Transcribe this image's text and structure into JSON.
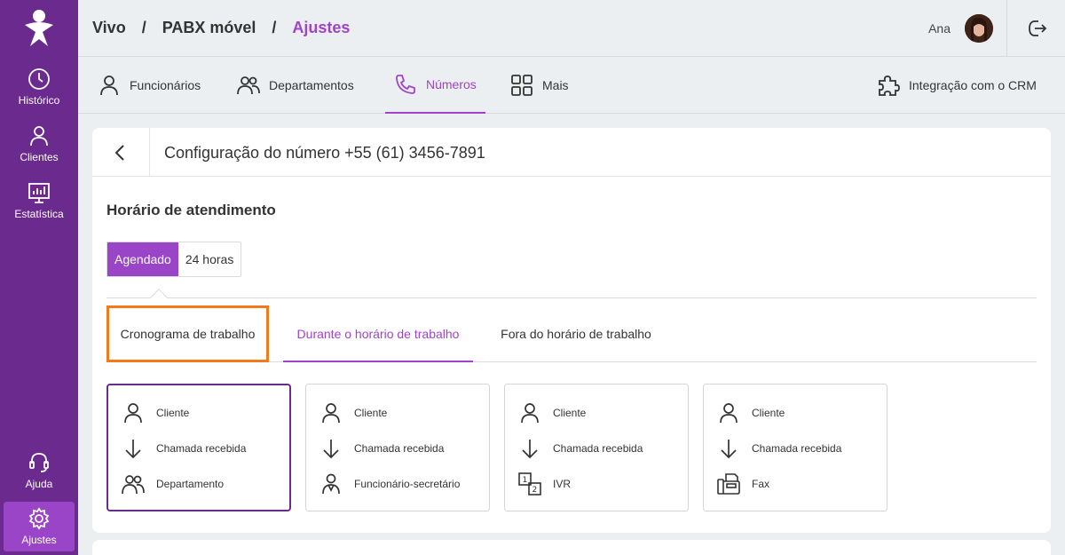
{
  "breadcrumb": [
    "Vivo",
    "PABX móvel",
    "Ajustes"
  ],
  "user": {
    "name": "Ana"
  },
  "sidebar": {
    "items": [
      {
        "label": "Histórico",
        "icon": "clock-icon"
      },
      {
        "label": "Clientes",
        "icon": "person-icon"
      },
      {
        "label": "Estatística",
        "icon": "chart-icon"
      },
      {
        "label": "Ajuda",
        "icon": "headset-icon"
      },
      {
        "label": "Ajustes",
        "icon": "gear-icon",
        "active": true
      }
    ]
  },
  "nav": {
    "tabs": [
      {
        "label": "Funcionários",
        "icon": "person-icon"
      },
      {
        "label": "Departamentos",
        "icon": "people-icon"
      },
      {
        "label": "Números",
        "icon": "phone-icon",
        "active": true
      },
      {
        "label": "Mais",
        "icon": "grid-icon"
      }
    ],
    "crm_label": "Integração com o CRM"
  },
  "card": {
    "title": "Configuração do número +55 (61) 3456-7891",
    "section_title": "Horário de atendimento",
    "toggle": [
      "Agendado",
      "24 horas"
    ],
    "subtabs": [
      "Cronograma de trabalho",
      "Durante o horário de trabalho",
      "Fora do horário de trabalho"
    ],
    "options": [
      {
        "rows": [
          "Cliente",
          "Chamada recebida",
          "Departamento"
        ],
        "selected": true
      },
      {
        "rows": [
          "Cliente",
          "Chamada recebida",
          "Funcionário-secretário"
        ]
      },
      {
        "rows": [
          "Cliente",
          "Chamada recebida",
          "IVR"
        ]
      },
      {
        "rows": [
          "Cliente",
          "Chamada recebida",
          "Fax"
        ]
      }
    ]
  },
  "colors": {
    "sidebar": "#6b2a8e",
    "accent": "#a143c9",
    "highlight": "#f07a1d"
  }
}
